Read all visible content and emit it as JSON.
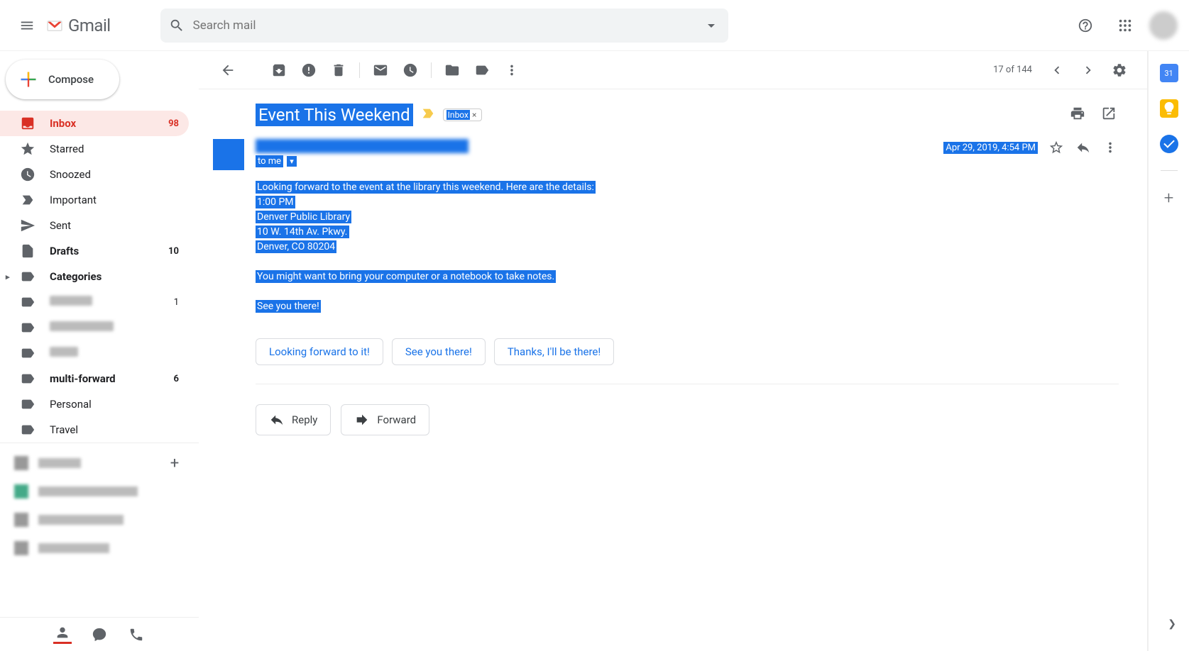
{
  "header": {
    "app_name": "Gmail",
    "search_placeholder": "Search mail"
  },
  "compose_label": "Compose",
  "sidebar": {
    "items": [
      {
        "label": "Inbox",
        "count": "98",
        "active": true,
        "bold": true,
        "icon": "inbox"
      },
      {
        "label": "Starred",
        "icon": "star"
      },
      {
        "label": "Snoozed",
        "icon": "clock"
      },
      {
        "label": "Important",
        "icon": "important"
      },
      {
        "label": "Sent",
        "icon": "send"
      },
      {
        "label": "Drafts",
        "count": "10",
        "bold": true,
        "icon": "draft"
      },
      {
        "label": "Categories",
        "bold": true,
        "icon": "label",
        "chevron": true
      },
      {
        "label": "",
        "count": "1",
        "icon": "label",
        "blur": 60
      },
      {
        "label": "",
        "icon": "label",
        "blur": 90
      },
      {
        "label": "",
        "icon": "label",
        "blur": 40
      },
      {
        "label": "multi-forward",
        "count": "6",
        "bold": true,
        "icon": "label"
      },
      {
        "label": "Personal",
        "icon": "label"
      },
      {
        "label": "Travel",
        "icon": "label"
      }
    ]
  },
  "toolbar": {
    "position": "17 of 144"
  },
  "email": {
    "subject": "Event This Weekend",
    "inbox_chip": "Inbox",
    "to_line": "to me",
    "date": "Apr 29, 2019, 4:54 PM",
    "body_lines": [
      "Looking forward to the event at the library this weekend. Here are the details:",
      "1:00 PM",
      "Denver Public Library",
      "10 W. 14th Av. Pkwy.",
      "Denver, CO 80204",
      "",
      "You might want to bring your computer or a notebook to take notes.",
      "",
      "See you there!"
    ],
    "smart_replies": [
      "Looking forward to it!",
      "See you there!",
      "Thanks, I'll be there!"
    ],
    "reply_label": "Reply",
    "forward_label": "Forward"
  }
}
